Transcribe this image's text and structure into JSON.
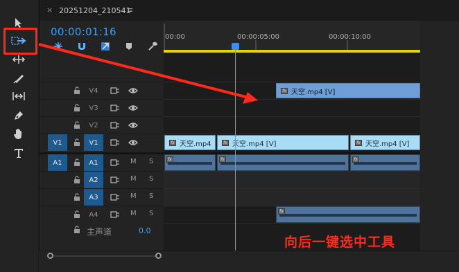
{
  "panel": {
    "tab_close": "×",
    "tab_title": "20251204_210541",
    "tab_menu": "≡",
    "timecode": "00:00:01:16"
  },
  "ruler": {
    "ticks": [
      "00:00",
      "00:00:05:00",
      "00:00:10:00"
    ]
  },
  "tracks": {
    "video": [
      {
        "name": "V4",
        "source": ""
      },
      {
        "name": "V3",
        "source": ""
      },
      {
        "name": "V2",
        "source": ""
      },
      {
        "name": "V1",
        "source": "V1"
      }
    ],
    "audio": [
      {
        "name": "A1",
        "source": "A1",
        "m": "M",
        "s": "S"
      },
      {
        "name": "A2",
        "source": "",
        "m": "M",
        "s": "S"
      },
      {
        "name": "A3",
        "source": "",
        "m": "M",
        "s": "S"
      },
      {
        "name": "A4",
        "source": "",
        "m": "M",
        "s": "S"
      }
    ],
    "master_label": "主声道",
    "master_value": "0.0"
  },
  "clips": {
    "v4_clip": "天空.mp4 [V]",
    "v1_clip_1": "天空.mp4",
    "v1_clip_2": "天空.mp4 [V]",
    "v1_clip_3": "天空.mp4 [V]",
    "fx_badge": "fx"
  },
  "annotation": {
    "text": "向后一键选中工具",
    "color": "#ff2a1a"
  },
  "colors": {
    "accent_blue": "#3ba1ff",
    "track_selected": "#1f5a8e",
    "work_area": "#e8d400"
  }
}
